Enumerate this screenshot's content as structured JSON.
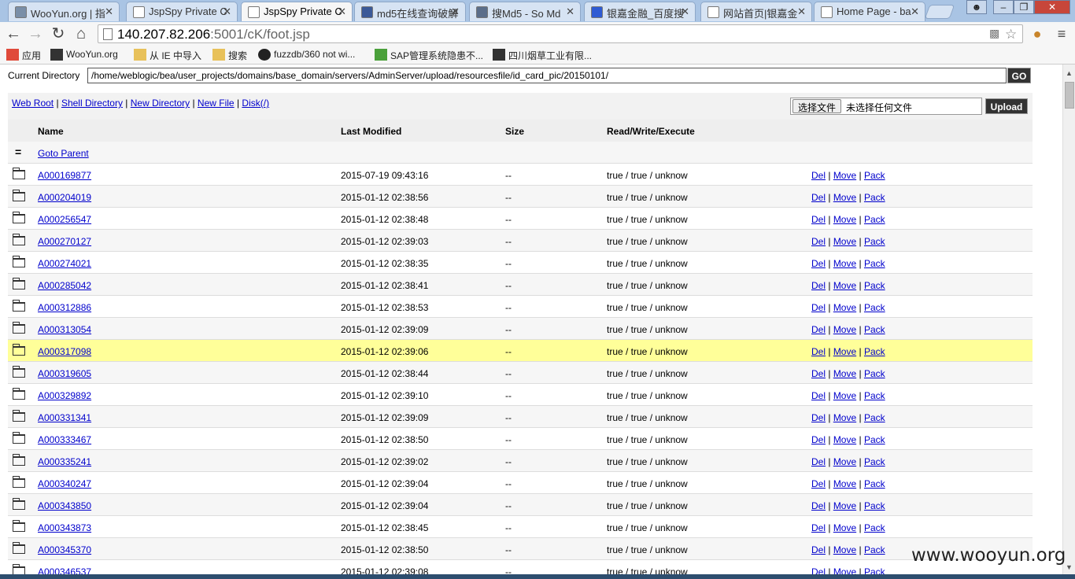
{
  "browser": {
    "tabs": [
      {
        "title": "WooYun.org | 指",
        "active": false,
        "color": "#7a8fa8"
      },
      {
        "title": "JspSpy Private C",
        "active": false,
        "color": "#ffffff"
      },
      {
        "title": "JspSpy Private C",
        "active": true,
        "color": "#ffffff"
      },
      {
        "title": "md5在线查询破解",
        "active": false,
        "color": "#3b5998"
      },
      {
        "title": "搜Md5 - So Md",
        "active": false,
        "color": "#5b6e8a"
      },
      {
        "title": "银嘉金融_百度搜",
        "active": false,
        "color": "#2f5bd3"
      },
      {
        "title": "网站首页|银嘉金",
        "active": false,
        "color": "#ffffff"
      },
      {
        "title": "Home Page - ba",
        "active": false,
        "color": "#ffffff"
      }
    ],
    "url_host": "140.207.82.206",
    "url_rest": ":5001/cK/foot.jsp",
    "bookmarks": [
      {
        "label": "应用",
        "icon": "apps-icon"
      },
      {
        "label": "WooYun.org",
        "icon": "wooyun-icon"
      },
      {
        "label": "从 IE 中导入",
        "icon": "folder-icon"
      },
      {
        "label": "搜索",
        "icon": "folder-icon"
      },
      {
        "label": "fuzzdb/360 not wi...",
        "icon": "github-icon"
      },
      {
        "label": "SAP管理系统隐患不...",
        "icon": "check-icon"
      },
      {
        "label": "四川烟草工业有限...",
        "icon": "wooyun-icon"
      }
    ]
  },
  "page": {
    "current_dir_label": "Current Directory",
    "current_dir_value": "/home/weblogic/bea/user_projects/domains/base_domain/servers/AdminServer/upload/resourcesfile/id_card_pic/20150101/",
    "go_label": "GO",
    "links": {
      "web_root": "Web Root",
      "shell_directory": "Shell Directory",
      "new_directory": "New Directory",
      "new_file": "New File",
      "disk": "Disk(/)"
    },
    "choose_file": "选择文件",
    "no_file": "未选择任何文件",
    "upload": "Upload",
    "columns": {
      "name": "Name",
      "modified": "Last Modified",
      "size": "Size",
      "rwx": "Read/Write/Execute"
    },
    "goto_parent": "Goto Parent",
    "parent_icon": "=",
    "actions": {
      "del": "Del",
      "move": "Move",
      "pack": "Pack"
    },
    "rows": [
      {
        "name": "A000169877",
        "modified": "2015-07-19 09:43:16",
        "size": "--",
        "rwx": "true / true / unknow"
      },
      {
        "name": "A000204019",
        "modified": "2015-01-12 02:38:56",
        "size": "--",
        "rwx": "true / true / unknow"
      },
      {
        "name": "A000256547",
        "modified": "2015-01-12 02:38:48",
        "size": "--",
        "rwx": "true / true / unknow"
      },
      {
        "name": "A000270127",
        "modified": "2015-01-12 02:39:03",
        "size": "--",
        "rwx": "true / true / unknow"
      },
      {
        "name": "A000274021",
        "modified": "2015-01-12 02:38:35",
        "size": "--",
        "rwx": "true / true / unknow"
      },
      {
        "name": "A000285042",
        "modified": "2015-01-12 02:38:41",
        "size": "--",
        "rwx": "true / true / unknow"
      },
      {
        "name": "A000312886",
        "modified": "2015-01-12 02:38:53",
        "size": "--",
        "rwx": "true / true / unknow"
      },
      {
        "name": "A000313054",
        "modified": "2015-01-12 02:39:09",
        "size": "--",
        "rwx": "true / true / unknow"
      },
      {
        "name": "A000317098",
        "modified": "2015-01-12 02:39:06",
        "size": "--",
        "rwx": "true / true / unknow",
        "highlight": true
      },
      {
        "name": "A000319605",
        "modified": "2015-01-12 02:38:44",
        "size": "--",
        "rwx": "true / true / unknow"
      },
      {
        "name": "A000329892",
        "modified": "2015-01-12 02:39:10",
        "size": "--",
        "rwx": "true / true / unknow"
      },
      {
        "name": "A000331341",
        "modified": "2015-01-12 02:39:09",
        "size": "--",
        "rwx": "true / true / unknow"
      },
      {
        "name": "A000333467",
        "modified": "2015-01-12 02:38:50",
        "size": "--",
        "rwx": "true / true / unknow"
      },
      {
        "name": "A000335241",
        "modified": "2015-01-12 02:39:02",
        "size": "--",
        "rwx": "true / true / unknow"
      },
      {
        "name": "A000340247",
        "modified": "2015-01-12 02:39:04",
        "size": "--",
        "rwx": "true / true / unknow"
      },
      {
        "name": "A000343850",
        "modified": "2015-01-12 02:39:04",
        "size": "--",
        "rwx": "true / true / unknow"
      },
      {
        "name": "A000343873",
        "modified": "2015-01-12 02:38:45",
        "size": "--",
        "rwx": "true / true / unknow"
      },
      {
        "name": "A000345370",
        "modified": "2015-01-12 02:38:50",
        "size": "--",
        "rwx": "true / true / unknow"
      },
      {
        "name": "A000346537",
        "modified": "2015-01-12 02:39:08",
        "size": "--",
        "rwx": "true / true / unknow"
      }
    ]
  },
  "watermark": "www.wooyun.org"
}
